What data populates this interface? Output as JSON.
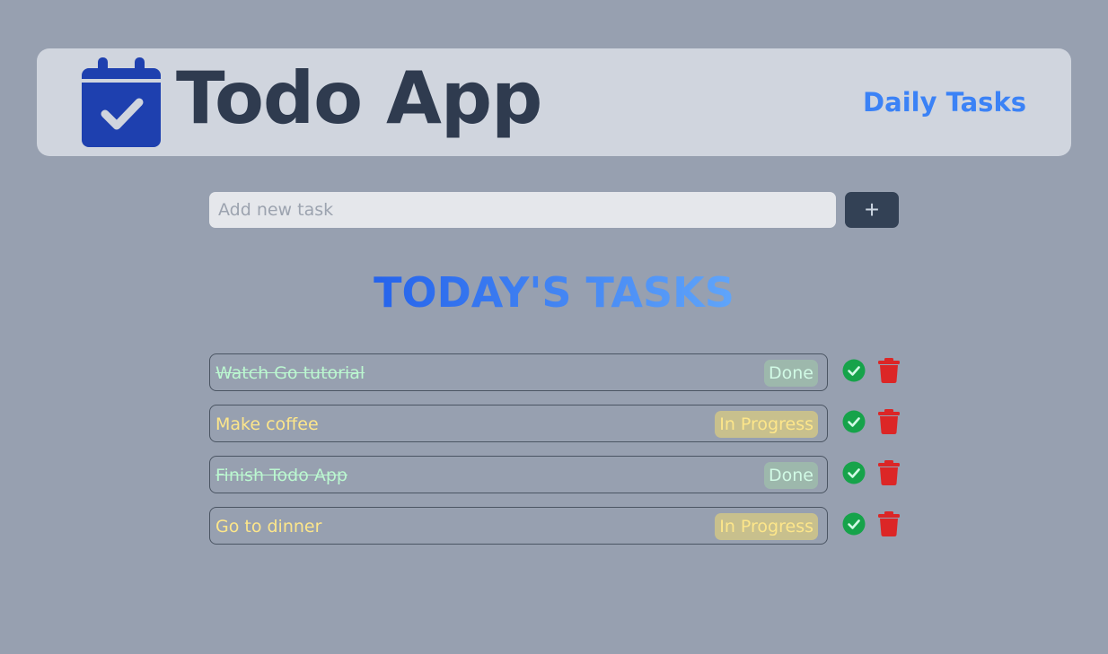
{
  "header": {
    "logo_icon": "calendar-check-icon",
    "title": "Todo App",
    "link_label": "Daily Tasks"
  },
  "add_task": {
    "placeholder": "Add new task",
    "value": "",
    "button_label": "+"
  },
  "section_title": "TODAY'S TASKS",
  "tasks": [
    {
      "text": "Watch Go tutorial",
      "status": "Done",
      "completed": true
    },
    {
      "text": "Make coffee",
      "status": "In Progress",
      "completed": false
    },
    {
      "text": "Finish Todo App",
      "status": "Done",
      "completed": true
    },
    {
      "text": "Go to dinner",
      "status": "In Progress",
      "completed": false
    }
  ],
  "colors": {
    "background": "#97a0b0",
    "header_bg": "#d0d5de",
    "accent": "#3b82f6",
    "done_text": "#bbf7d0",
    "progress_text": "#fde68a",
    "check": "#16a34a",
    "delete": "#dc2626"
  }
}
